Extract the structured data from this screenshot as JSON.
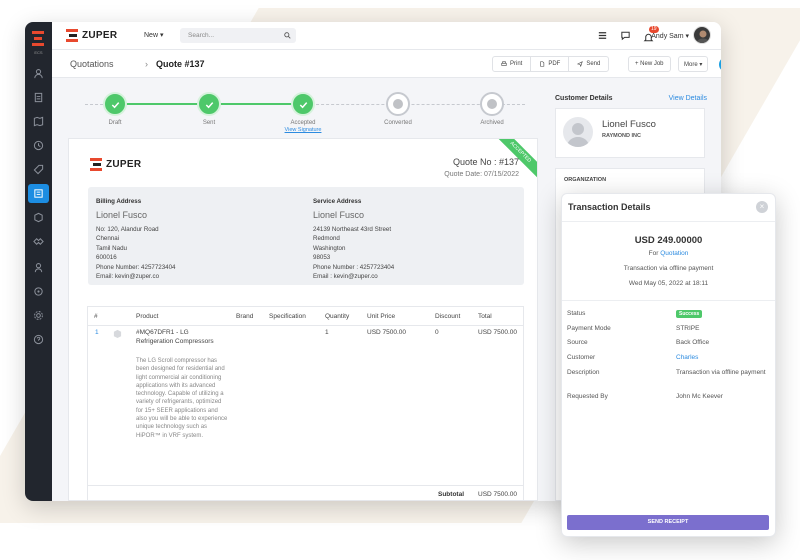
{
  "colors": {
    "accent": "#1c9fe2",
    "success": "#4ec86a",
    "brand": "#e8492e",
    "sidebar": "#22262e",
    "button_purple": "#7b6fce",
    "link": "#2c8be0"
  },
  "sidebar": {
    "logo_caption": "ECS",
    "items": [
      {
        "icon": "users-icon"
      },
      {
        "icon": "clipboard-icon"
      },
      {
        "icon": "map-icon"
      },
      {
        "icon": "clock-icon"
      },
      {
        "icon": "tag-icon"
      },
      {
        "icon": "quotation-icon",
        "active": true
      },
      {
        "icon": "box-icon"
      },
      {
        "icon": "handshake-icon"
      },
      {
        "icon": "user-icon"
      },
      {
        "icon": "tag-alt-icon"
      },
      {
        "icon": "gear-icon"
      },
      {
        "icon": "help-icon"
      }
    ]
  },
  "topbar": {
    "brand": "ZUPER",
    "new_label": "New ▾",
    "search_placeholder": "Search...",
    "notif_count": "19",
    "user_name": "Andy Sam ▾"
  },
  "breadcrumb": {
    "parent": "Quotations",
    "separator": "›",
    "current": "Quote #137"
  },
  "actions": {
    "print": "Print",
    "pdf": "PDF",
    "send": "Send",
    "new_job": "+ New Job",
    "more": "More ▾",
    "fab": "↑"
  },
  "stepper": {
    "steps": [
      {
        "label": "Draft",
        "done": true
      },
      {
        "label": "Sent",
        "done": true
      },
      {
        "label": "Accepted",
        "done": true,
        "sub": "View Signature"
      },
      {
        "label": "Converted",
        "done": false
      },
      {
        "label": "Archived",
        "done": false
      }
    ]
  },
  "quote": {
    "brand": "ZUPER",
    "ribbon": "ACCEPTED",
    "number": "Quote No : #137",
    "date": "Quote Date: 07/15/2022",
    "billing": {
      "heading": "Billing Address",
      "name": "Lionel Fusco",
      "line1": "No: 120, Alandur Road",
      "line2": "Chennai",
      "line3": "Tamil Nadu",
      "line4": "600016",
      "phone": "Phone Number: 4257723404",
      "email": "Email: kevin@zuper.co"
    },
    "service": {
      "heading": "Service Address",
      "name": "Lionel Fusco",
      "line1": "24139 Northeast 43rd Street",
      "line2": "Redmond",
      "line3": "Washington",
      "line4": "98053",
      "phone": "Phone Number : 4257723404",
      "email": "Email : kevin@zuper.co"
    },
    "table": {
      "headers": [
        "#",
        "Product",
        "Brand",
        "Specification",
        "Quantity",
        "Unit Price",
        "Discount",
        "Total"
      ],
      "row": {
        "num": "1",
        "product_name": "#MQ67DFR1 - LG Refrigeration Compressors",
        "description": "The LG Scroll compressor has been designed for residential and light commercial air conditioning applications with its advanced technology. Capable of utilizing a variety of refrigerants, optimized for 15+ SEER applications and also you will be able to experience unique technology such as HiPOR™ in VRF system.",
        "quantity": "1",
        "unit_price": "USD 7500.00",
        "discount": "0",
        "total": "USD 7500.00"
      },
      "subtotal_label": "Subtotal",
      "subtotal_value": "USD 7500.00"
    }
  },
  "customer": {
    "section_title": "Customer Details",
    "view_link": "View Details",
    "name": "Lionel Fusco",
    "company": "RAYMOND INC",
    "org_title": "ORGANIZATION"
  },
  "transaction": {
    "title": "Transaction Details",
    "close": "×",
    "amount": "USD 249.00000",
    "for_prefix": "For",
    "for_link": "Quotation",
    "via": "Transaction via offline payment",
    "date": "Wed May 05, 2022 at 18:11",
    "rows": {
      "status_label": "Status",
      "status_value": "Success",
      "mode_label": "Payment Mode",
      "mode_value": "STRIPE",
      "source_label": "Source",
      "source_value": "Back Office",
      "customer_label": "Customer",
      "customer_value": "Charles",
      "desc_label": "Description",
      "desc_value": "Transaction via offline payment",
      "req_label": "Requested By",
      "req_value": "John Mc Keever"
    },
    "button": "SEND RECEIPT"
  }
}
